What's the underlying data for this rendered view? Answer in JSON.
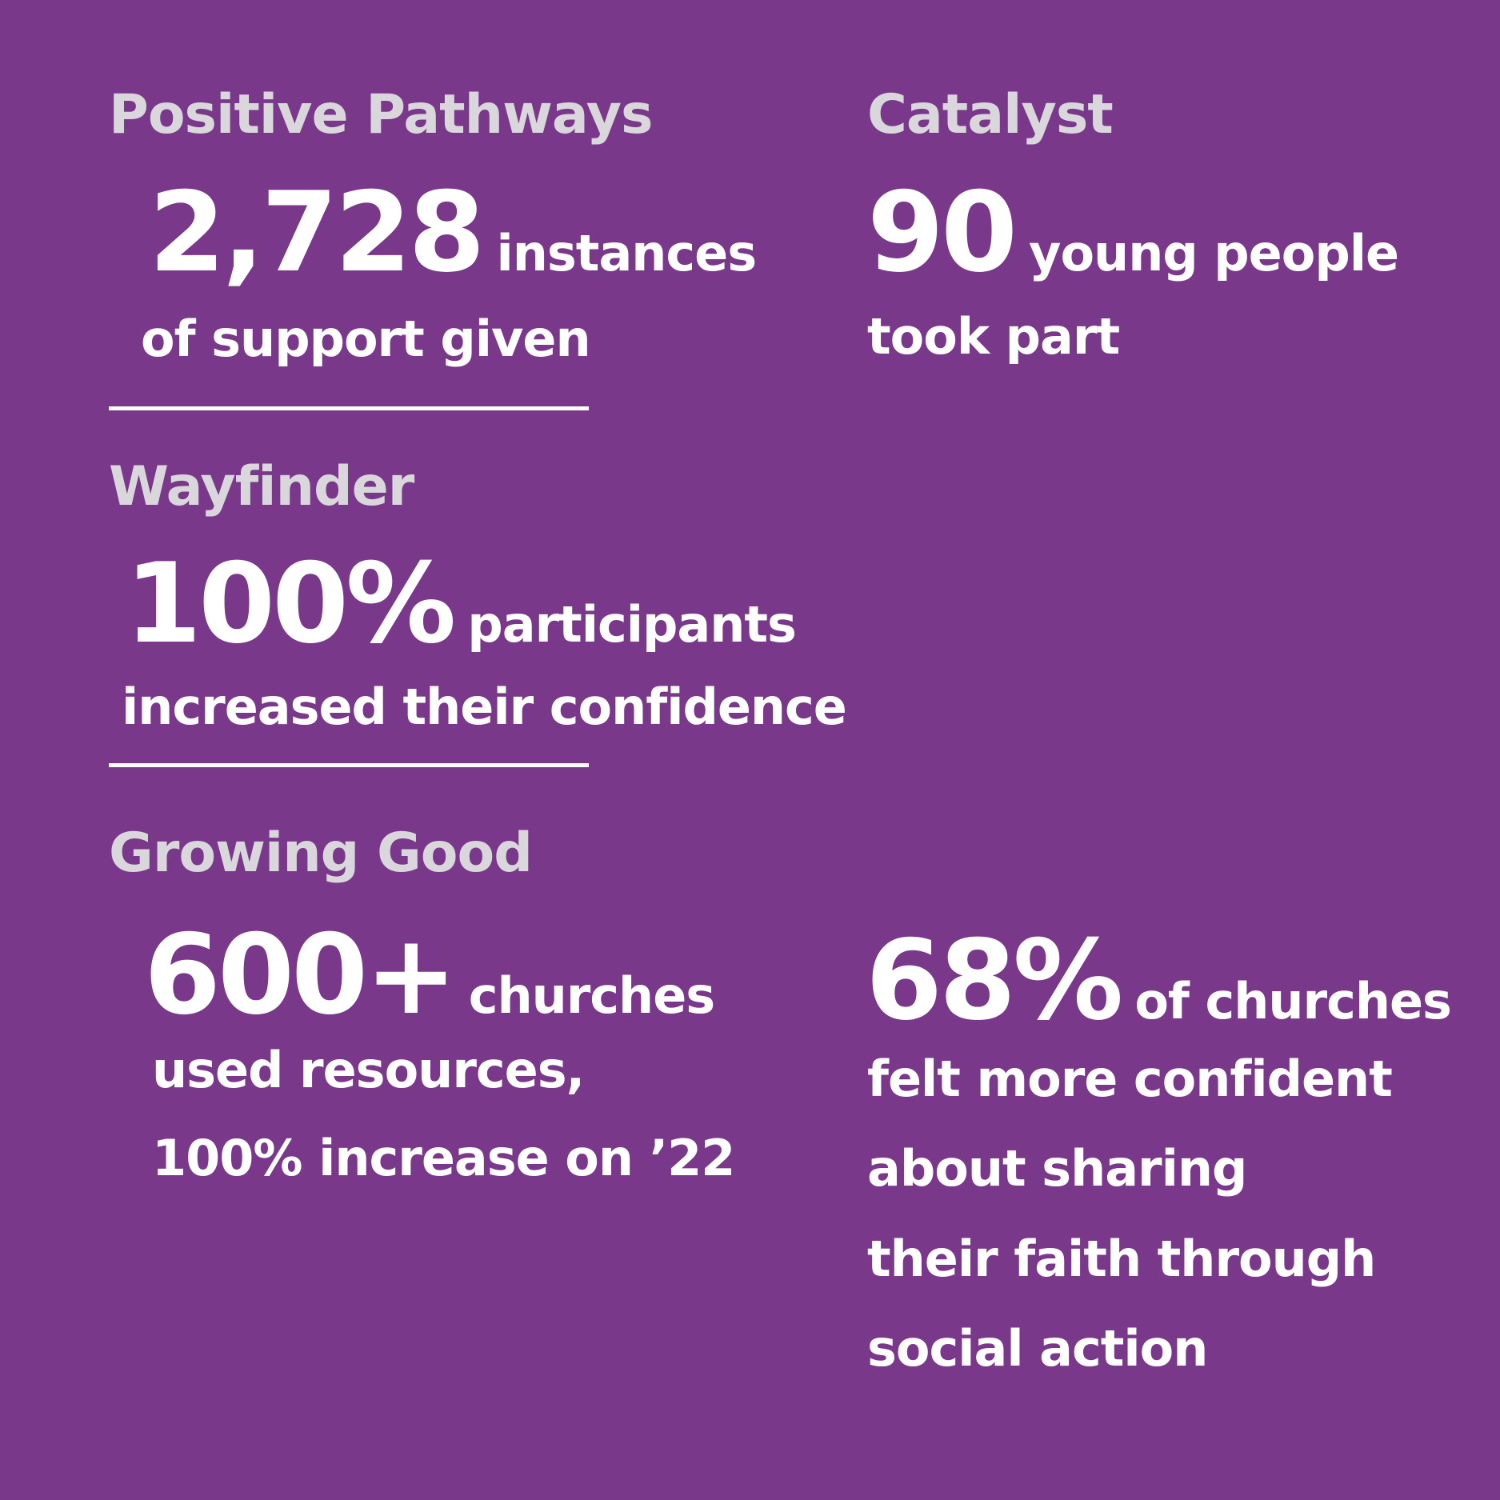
{
  "colors": {
    "background": "#7a388b",
    "heading": "#d9d6dc",
    "text": "#ffffff"
  },
  "positive_pathways": {
    "heading": "Positive Pathways",
    "number": "2,728",
    "suffix": "instances",
    "line2": "of support given"
  },
  "catalyst": {
    "heading": "Catalyst",
    "number": "90",
    "suffix": "young people",
    "line2": "took part"
  },
  "wayfinder": {
    "heading": "Wayfinder",
    "number": "100%",
    "suffix": "participants",
    "line2": "increased their confidence"
  },
  "growing_good": {
    "heading": "Growing Good",
    "stat1": {
      "number": "600+",
      "suffix": "churches",
      "line2": "used resources,",
      "line3": "100% increase on ’22"
    },
    "stat2": {
      "number": "68%",
      "suffix": "of churches",
      "line2": "felt more confident",
      "line3": "about sharing",
      "line4": "their faith through",
      "line5": "social action"
    }
  }
}
